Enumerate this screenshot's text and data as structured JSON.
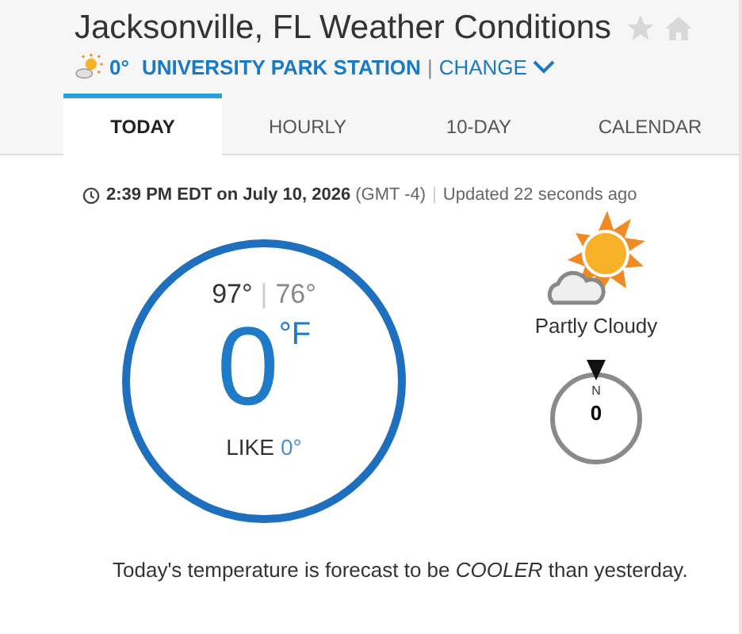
{
  "header": {
    "title": "Jacksonville, FL Weather Conditions",
    "favorite": false,
    "station_temp": "0°",
    "station": "UNIVERSITY PARK STATION",
    "separator": "|",
    "change": "CHANGE"
  },
  "tabs": [
    {
      "label": "TODAY",
      "selected": true
    },
    {
      "label": "HOURLY",
      "selected": false
    },
    {
      "label": "10-DAY",
      "selected": false
    },
    {
      "label": "CALENDAR",
      "selected": false
    }
  ],
  "timestamp": {
    "time": "**2:39 PM EDT on July 10, 2026** (GMT -4)",
    "separator": "|",
    "updated": "Updated 22 seconds ago"
  },
  "current": {
    "high": "97°",
    "separator": "|",
    "low": "76°",
    "temp": "0",
    "unit": "°F",
    "feels_label": "LIKE",
    "feels_value": "0°",
    "condition": "Partly Cloudy",
    "wind_dir": "N",
    "wind_speed": "0"
  },
  "forecast_note": "Today's temperature is forecast to be *COOLER* than yesterday."
}
